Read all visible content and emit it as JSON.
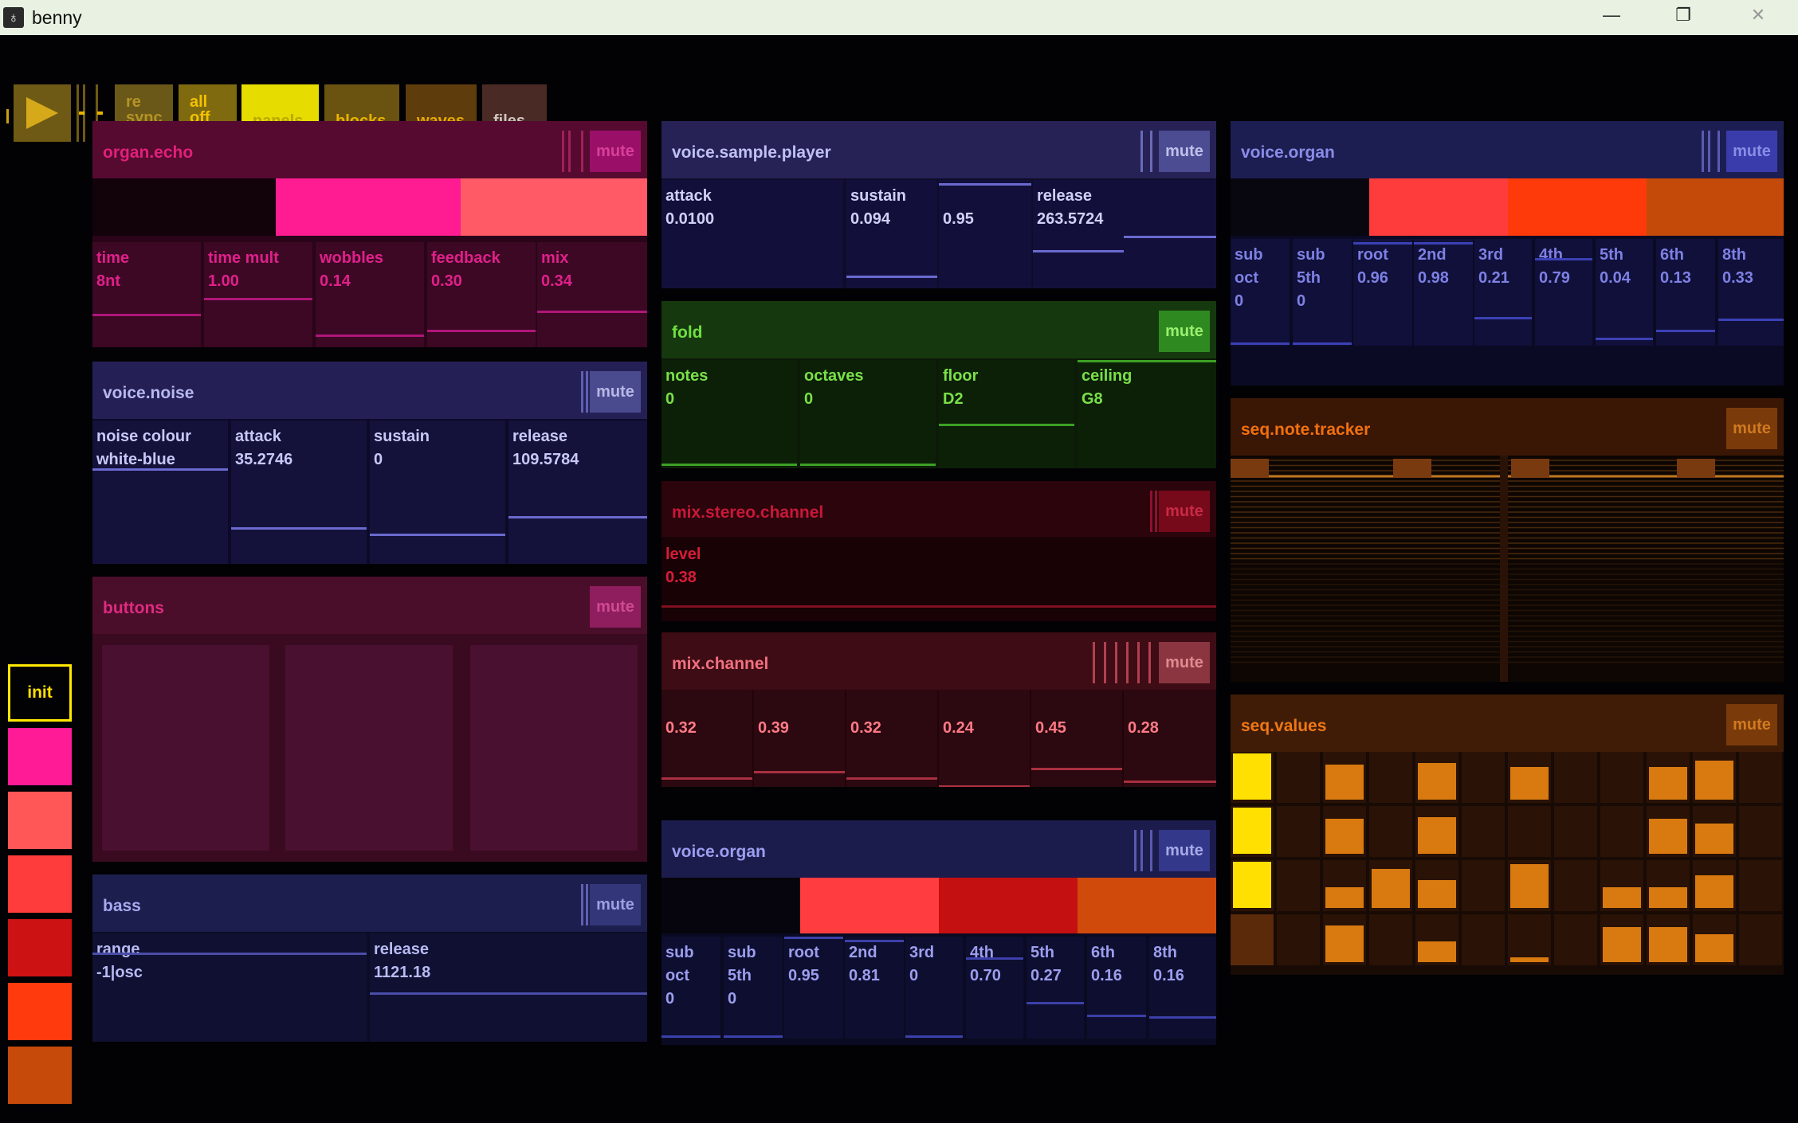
{
  "window": {
    "title": "benny",
    "minimize": "—",
    "maximize": "❐",
    "close": "✕"
  },
  "colors": {
    "bg": "#020205",
    "yellow": "#ffe800",
    "pink": "#ff1a8a",
    "orange": "#e07a10",
    "red": "#d01010",
    "blue": "#3a3aa0",
    "green": "#38a820"
  },
  "toolbar": {
    "play": "play-icon",
    "resync": "re\nsync",
    "alloff": "all\noff",
    "panels": "panels",
    "blocks": "blocks",
    "waves": "waves",
    "files": "files"
  },
  "sidebar": {
    "init": "init"
  },
  "mute": "mute",
  "organ_echo": {
    "title": "organ.echo",
    "params": [
      {
        "label": "time",
        "value": "8nt"
      },
      {
        "label": "time mult",
        "value": "1.00"
      },
      {
        "label": "wobbles",
        "value": "0.14"
      },
      {
        "label": "feedback",
        "value": "0.30"
      },
      {
        "label": "mix",
        "value": "0.34"
      }
    ]
  },
  "voice_noise": {
    "title": "voice.noise",
    "params": [
      {
        "label": "noise colour",
        "value": "white-blue"
      },
      {
        "label": "attack",
        "value": "35.2746"
      },
      {
        "label": "sustain",
        "value": "0"
      },
      {
        "label": "release",
        "value": "109.5784"
      }
    ]
  },
  "buttons": {
    "title": "buttons"
  },
  "bass": {
    "title": "bass",
    "params": [
      {
        "label": "range",
        "value": "-1|osc"
      },
      {
        "label": "release",
        "value": "1121.18"
      }
    ]
  },
  "sample_player": {
    "title": "voice.sample.player",
    "params": [
      {
        "label": "attack",
        "value": "0.0100"
      },
      {
        "label": "sustain",
        "value": "0.094"
      },
      {
        "label": "",
        "value": "0.95"
      },
      {
        "label": "release",
        "value": "263.5724"
      }
    ]
  },
  "fold": {
    "title": "fold",
    "params": [
      {
        "label": "notes",
        "value": "0"
      },
      {
        "label": "octaves",
        "value": "0"
      },
      {
        "label": "floor",
        "value": "D2"
      },
      {
        "label": "ceiling",
        "value": "G8"
      }
    ]
  },
  "stereo": {
    "title": "mix.stereo.channel",
    "label": "level",
    "value": "0.38"
  },
  "mix_channel": {
    "title": "mix.channel",
    "label": "level",
    "values": [
      "0.32",
      "0.39",
      "0.32",
      "0.24",
      "0.45",
      "0.28"
    ]
  },
  "voice_organ_mid": {
    "title": "voice.organ",
    "params": [
      {
        "label": "sub\noct",
        "value": "0"
      },
      {
        "label": "sub\n5th",
        "value": "0"
      },
      {
        "label": "root",
        "value": "0.95"
      },
      {
        "label": "2nd",
        "value": "0.81"
      },
      {
        "label": "3rd",
        "value": "0"
      },
      {
        "label": "4th",
        "value": "0.70"
      },
      {
        "label": "5th",
        "value": "0.27"
      },
      {
        "label": "6th",
        "value": "0.16"
      },
      {
        "label": "8th",
        "value": "0.16"
      }
    ]
  },
  "voice_organ_right": {
    "title": "voice.organ",
    "params": [
      {
        "label": "sub\noct",
        "value": "0"
      },
      {
        "label": "sub\n5th",
        "value": "0"
      },
      {
        "label": "root",
        "value": "0.96"
      },
      {
        "label": "2nd",
        "value": "0.98"
      },
      {
        "label": "3rd",
        "value": "0.21"
      },
      {
        "label": "4th",
        "value": "0.79"
      },
      {
        "label": "5th",
        "value": "0.04"
      },
      {
        "label": "6th",
        "value": "0.13"
      },
      {
        "label": "8th",
        "value": "0.33"
      }
    ]
  },
  "seq_tracker": {
    "title": "seq.note.tracker"
  },
  "seq_values": {
    "title": "seq.values"
  }
}
